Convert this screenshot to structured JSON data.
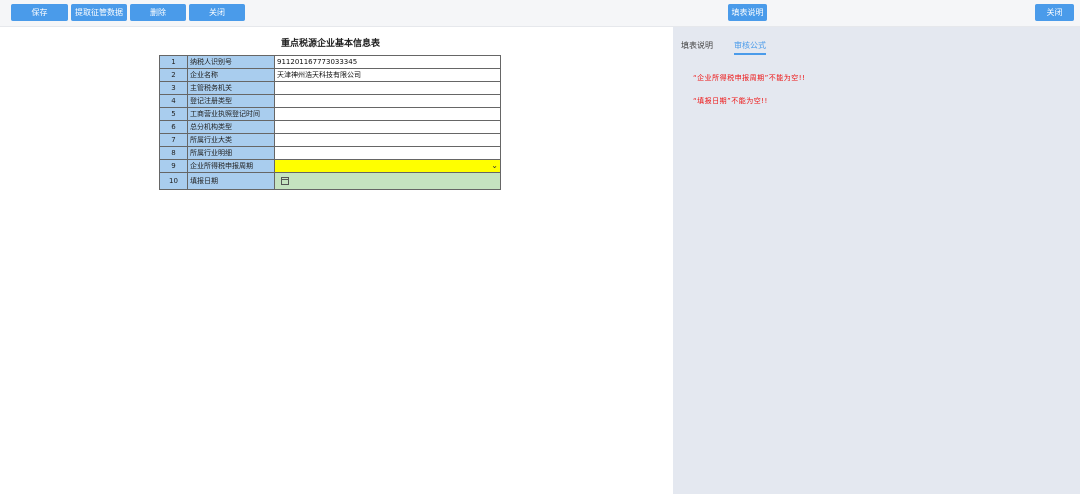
{
  "toolbar": {
    "save": "保存",
    "fetch": "提取征管数据",
    "delete": "删除",
    "close": "关闭",
    "help": "填表说明",
    "close_right": "关闭"
  },
  "form": {
    "title": "重点税源企业基本信息表",
    "rows": [
      {
        "no": "1",
        "label": "纳税人识别号",
        "value": "911201167773033345"
      },
      {
        "no": "2",
        "label": "企业名称",
        "value": "天津神州浩天科技有限公司"
      },
      {
        "no": "3",
        "label": "主管税务机关",
        "value": ""
      },
      {
        "no": "4",
        "label": "登记注册类型",
        "value": ""
      },
      {
        "no": "5",
        "label": "工商营业执照登记时间",
        "value": ""
      },
      {
        "no": "6",
        "label": "总分机构类型",
        "value": ""
      },
      {
        "no": "7",
        "label": "所属行业大类",
        "value": ""
      },
      {
        "no": "8",
        "label": "所属行业明细",
        "value": ""
      },
      {
        "no": "9",
        "label": "企业所得税申报周期",
        "value": ""
      },
      {
        "no": "10",
        "label": "填报日期",
        "value": ""
      }
    ]
  },
  "side": {
    "tabs": [
      "填表说明",
      "审核公式"
    ],
    "active_tab": "审核公式",
    "errors": [
      "“企业所得税申报周期”不能为空!!",
      "“填报日期”不能为空!!"
    ],
    "error_color": "#ee1111"
  },
  "colors": {
    "accent": "#4a9bea",
    "label_bg": "#a9cdee",
    "required_select_bg": "#ffff00",
    "date_cell_bg": "#c5e3c0"
  },
  "icons": {
    "select_arrow": "chevron-down-icon",
    "date_picker": "calendar-icon"
  }
}
